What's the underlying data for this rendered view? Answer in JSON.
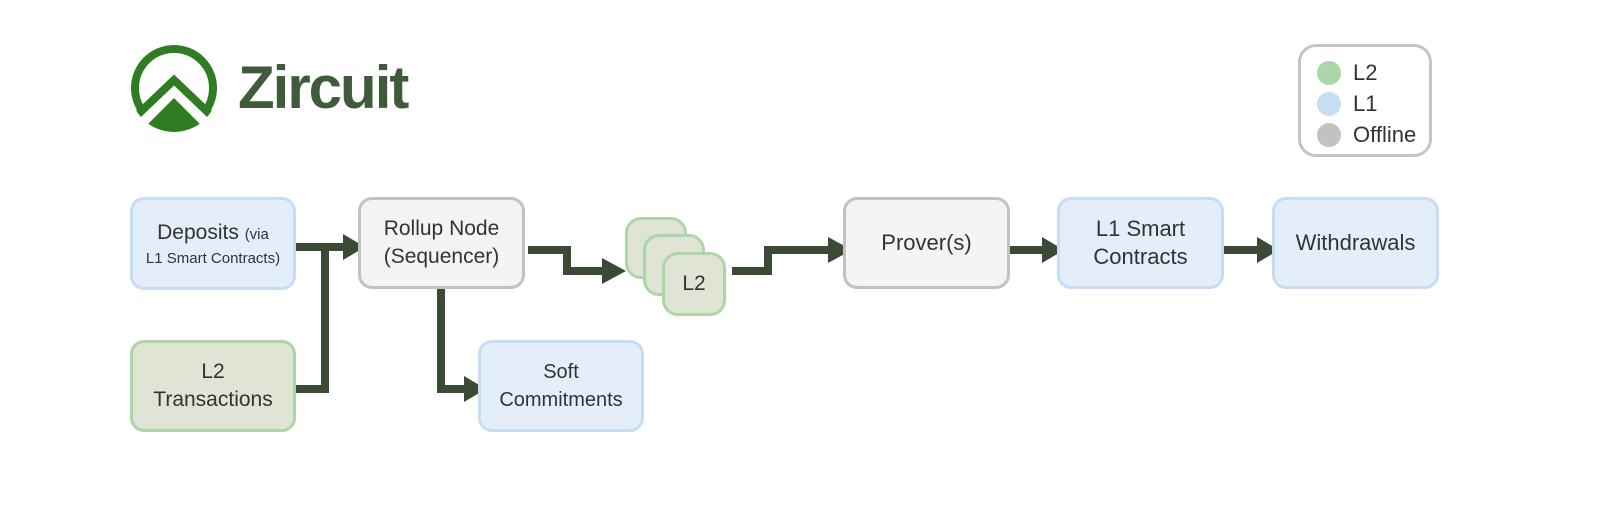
{
  "brand": {
    "name": "Zircuit",
    "logo_icon": "mountain-circle-logo-icon",
    "color": "#3f5b3c",
    "mark_color": "#2e7d22"
  },
  "legend": {
    "items": [
      {
        "label": "L2",
        "color": "#acd6a7"
      },
      {
        "label": "L1",
        "color": "#c7ddf3"
      },
      {
        "label": "Offline",
        "color": "#c2c2c2"
      }
    ]
  },
  "colors": {
    "l1_fill": "#e3eefa",
    "l1_border": "#c7ddf3",
    "l2_fill": "#e0e4d4",
    "l2_border": "#acd6a7",
    "offline_fill": "#f4f4f4",
    "offline_border": "#c2c2c2",
    "arrow": "#3a4a34"
  },
  "nodes": {
    "deposits": {
      "title": "Deposits",
      "suffix": "(via",
      "subtitle": "L1 Smart Contracts)",
      "layer": "L1"
    },
    "l2_transactions": {
      "line1": "L2",
      "line2": "Transactions",
      "layer": "L2"
    },
    "rollup_node": {
      "line1": "Rollup Node",
      "line2": "(Sequencer)",
      "layer": "Offline"
    },
    "soft_commitments": {
      "line1": "Soft",
      "line2": "Commitments",
      "layer": "L1"
    },
    "l2_batches": {
      "label": "L2",
      "layer": "L2"
    },
    "provers": {
      "label": "Prover(s)",
      "layer": "Offline"
    },
    "l1_smart_contracts": {
      "line1": "L1 Smart",
      "line2": "Contracts",
      "layer": "L1"
    },
    "withdrawals": {
      "label": "Withdrawals",
      "layer": "L1"
    }
  },
  "edges": [
    {
      "from": "deposits",
      "to": "rollup_node"
    },
    {
      "from": "l2_transactions",
      "to": "rollup_node"
    },
    {
      "from": "rollup_node",
      "to": "soft_commitments"
    },
    {
      "from": "rollup_node",
      "to": "l2_batches"
    },
    {
      "from": "l2_batches",
      "to": "provers"
    },
    {
      "from": "provers",
      "to": "l1_smart_contracts"
    },
    {
      "from": "l1_smart_contracts",
      "to": "withdrawals"
    }
  ]
}
